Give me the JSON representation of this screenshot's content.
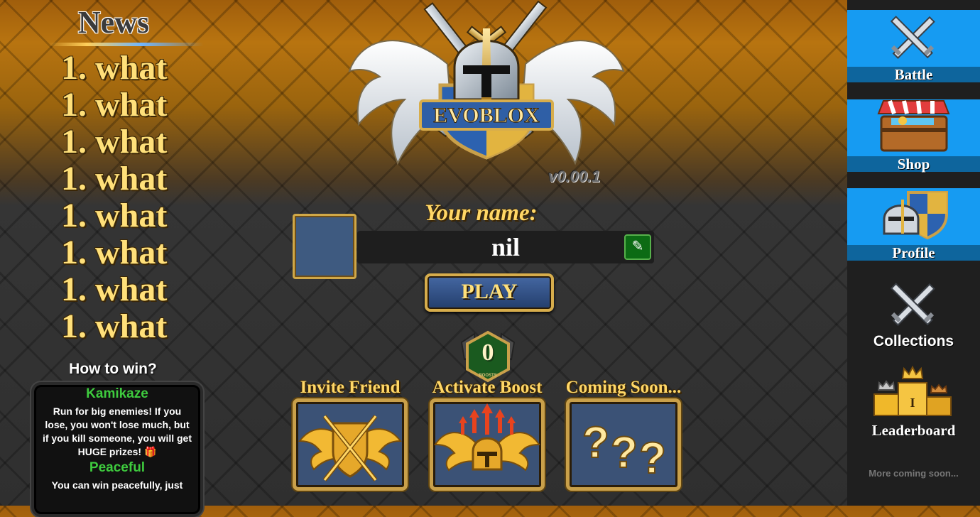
{
  "news": {
    "title": "News",
    "items": [
      "1. what",
      "1. what",
      "1. what",
      "1. what",
      "1. what",
      "1. what",
      "1. what",
      "1. what"
    ]
  },
  "how_to_win": {
    "title": "How to win?",
    "modes": [
      {
        "name": "Kamikaze",
        "description": "Run for big enemies! If you lose, you won't lose much, but if you kill someone, you will get HUGE prizes! 🎁"
      },
      {
        "name": "Peaceful",
        "description": "You can win peacefully, just"
      }
    ]
  },
  "logo": {
    "text": "EVOBLOX",
    "version": "v0.00.1"
  },
  "player": {
    "label": "Your name:",
    "name": "nil"
  },
  "play_label": "PLAY",
  "boosts": {
    "count": "0",
    "badge_text": "BOOSTS"
  },
  "actions": [
    {
      "label": "Invite Friend",
      "icon": "winged-shield-icon"
    },
    {
      "label": "Activate Boost",
      "icon": "winged-helmet-boost-icon"
    },
    {
      "label": "Coming Soon...",
      "icon": "question-marks-icon"
    }
  ],
  "menu": {
    "items": [
      {
        "label": "Battle",
        "icon": "crossed-swords-icon",
        "active": true
      },
      {
        "label": "Shop",
        "icon": "shop-chest-icon",
        "active": true
      },
      {
        "label": "Profile",
        "icon": "helmet-shield-icon",
        "active": true
      },
      {
        "label": "Collections",
        "icon": "crossed-swords-icon",
        "active": false
      },
      {
        "label": "Leaderboard",
        "icon": "podium-crowns-icon",
        "active": false
      }
    ],
    "more": "More coming soon..."
  },
  "colors": {
    "menu_active": "#169bf2",
    "gold": "#ffd766",
    "mode_green": "#3ecb3e"
  }
}
